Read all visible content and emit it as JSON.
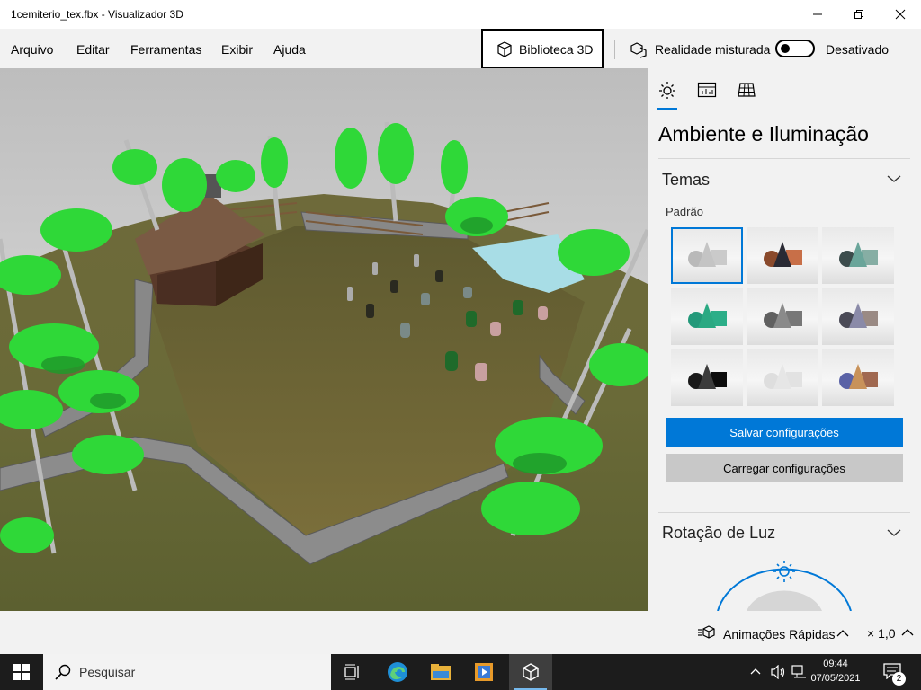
{
  "window": {
    "title": "1cemiterio_tex.fbx - Visualizador 3D",
    "controls": [
      "minimize-icon",
      "restore-icon",
      "close-icon"
    ]
  },
  "menu": {
    "items": [
      "Arquivo",
      "Editar",
      "Ferramentas",
      "Exibir",
      "Ajuda"
    ],
    "library_button": "Biblioteca 3D",
    "mixed_reality_label": "Realidade misturada",
    "mixed_reality_state": "Desativado",
    "mixed_reality_on": false
  },
  "panel": {
    "tabs": [
      {
        "name": "ambiente-e-iluminacao",
        "icon": "sun-icon",
        "active": true
      },
      {
        "name": "estatisticas",
        "icon": "stats-icon",
        "active": false
      },
      {
        "name": "grade",
        "icon": "grid-icon",
        "active": false
      }
    ],
    "title": "Ambiente e Iluminação",
    "themes_section": {
      "title": "Temas",
      "subtitle": "Padrão",
      "themes": [
        {
          "id": 1,
          "cone": "#c4c4c4",
          "sphere": "#b9b9b9",
          "cube": "#cacaca",
          "selected": true
        },
        {
          "id": 2,
          "cone": "#2a2a34",
          "sphere": "#8a4a2c",
          "cube": "#c86f48",
          "selected": false
        },
        {
          "id": 3,
          "cone": "#6aa59a",
          "sphere": "#3c4c4c",
          "cube": "#86aea4",
          "selected": false
        },
        {
          "id": 4,
          "cone": "#2aa982",
          "sphere": "#23997a",
          "cube": "#2cae88",
          "selected": false
        },
        {
          "id": 5,
          "cone": "#8a8a8a",
          "sphere": "#606060",
          "cube": "#777777",
          "selected": false
        },
        {
          "id": 6,
          "cone": "#8a8aa8",
          "sphere": "#4a4a56",
          "cube": "#9a8a84",
          "selected": false
        },
        {
          "id": 7,
          "cone": "#3c3c3c",
          "sphere": "#1a1a1a",
          "cube": "#0c0c0c",
          "selected": false
        },
        {
          "id": 8,
          "cone": "#e6e6e6",
          "sphere": "#dedede",
          "cube": "#e2e2e2",
          "selected": false
        },
        {
          "id": 9,
          "cone": "#c8925a",
          "sphere": "#5a62a6",
          "cube": "#a06850",
          "selected": false
        }
      ],
      "save_button": "Salvar configurações",
      "load_button": "Carregar configurações"
    },
    "light_rotation_section": {
      "title": "Rotação de Luz"
    }
  },
  "statusbar": {
    "animations_label": "Animações Rápidas",
    "speed_label": "× 1,0"
  },
  "taskbar": {
    "search_placeholder": "Pesquisar",
    "apps": [
      "task-view-icon",
      "edge-icon",
      "file-explorer-icon",
      "media-player-icon",
      "3d-viewer-icon"
    ],
    "time": "09:44",
    "date": "07/05/2021",
    "notification_count": "2"
  },
  "colors": {
    "accent": "#0078d7",
    "panel_bg": "#f2f2f2",
    "taskbar_bg": "#1c1c1c"
  }
}
